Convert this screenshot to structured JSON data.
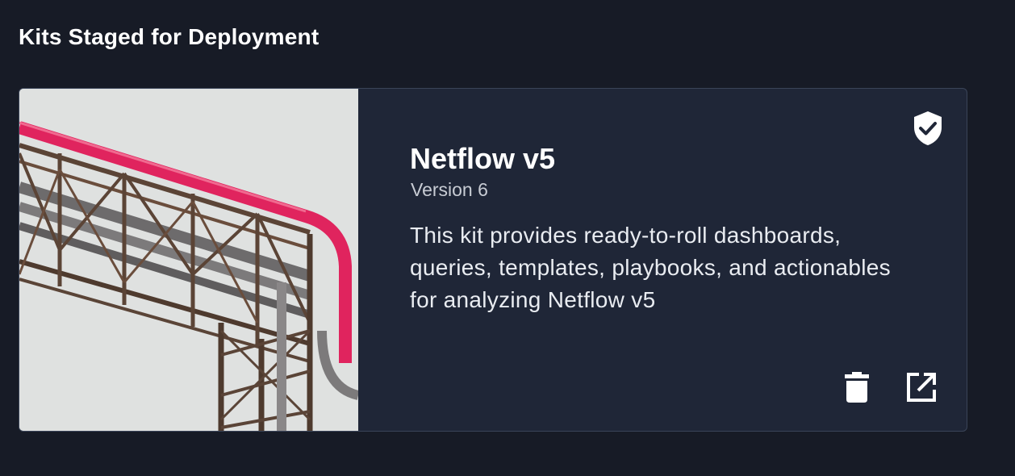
{
  "section": {
    "title": "Kits Staged for Deployment"
  },
  "kit": {
    "name": "Netflow v5",
    "version": "Version 6",
    "description": "This kit provides ready-to-roll dashboards, queries, templates, playbooks, and actionables for analyzing Netflow v5",
    "image": "industrial-pipes-image",
    "status_icon": "shield-check-icon",
    "actions": [
      {
        "icon": "trash-icon",
        "action": "delete"
      },
      {
        "icon": "open-in-new-icon",
        "action": "open"
      }
    ]
  },
  "colors": {
    "background": "#171b26",
    "card": "#1f2637",
    "card_border": "#3a4458",
    "pipe_accent": "#e0245e"
  }
}
